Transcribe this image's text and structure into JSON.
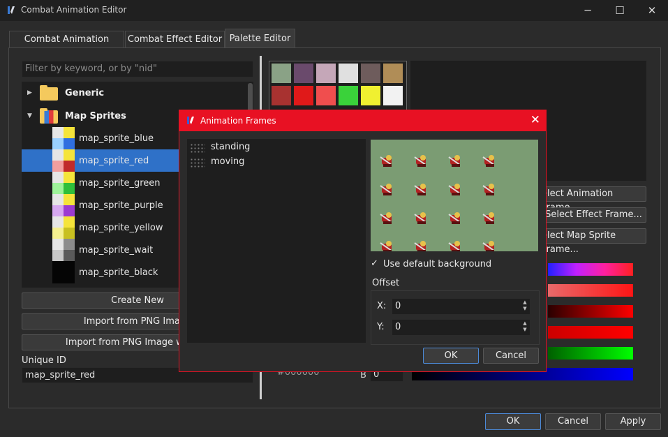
{
  "window": {
    "title": "Combat Animation Editor",
    "minimize": "─",
    "maximize": "☐",
    "close": "✕"
  },
  "tabs": [
    {
      "label": "Combat Animation Editor"
    },
    {
      "label": "Combat Effect Editor"
    },
    {
      "label": "Palette Editor"
    }
  ],
  "left": {
    "filter_placeholder": "Filter by keyword, or by \"nid\"",
    "groups": [
      {
        "label": "Generic",
        "arrow": "▶"
      },
      {
        "label": "Map Sprites",
        "arrow": "▼"
      }
    ],
    "items": [
      {
        "label": "map_sprite_blue"
      },
      {
        "label": "map_sprite_red"
      },
      {
        "label": "map_sprite_green"
      },
      {
        "label": "map_sprite_purple"
      },
      {
        "label": "map_sprite_yellow"
      },
      {
        "label": "map_sprite_wait"
      },
      {
        "label": "map_sprite_black"
      }
    ],
    "buttons": {
      "create_new": "Create New",
      "import_png": "Import from PNG Image",
      "import_png_with": "Import from PNG Image with ba"
    },
    "unique_id_label": "Unique ID",
    "unique_id_value": "map_sprite_red"
  },
  "palette": {
    "swatches": [
      "#8aa286",
      "#6a4a6c",
      "#c5a7b8",
      "#e0e0e0",
      "#6e5c5c",
      "#b08d57",
      "#a83230",
      "#e01919",
      "#f04e4e",
      "#3ad23a",
      "#f0f030",
      "#f2f2f2"
    ],
    "right_buttons": [
      "elect Animation Frame...",
      "Select Effect Frame...",
      "elect Map Sprite Frame..."
    ],
    "hex_partial": "#000000",
    "b_label": "B",
    "b_value": "0"
  },
  "dialog": {
    "title": "Animation Frames",
    "close": "✕",
    "frames": [
      {
        "label": "standing"
      },
      {
        "label": "moving"
      }
    ],
    "checkbox_mark": "✓",
    "use_default_bg": "Use default background",
    "offset_label": "Offset",
    "x_label": "X:",
    "x_value": "0",
    "y_label": "Y:",
    "y_value": "0",
    "ok": "OK",
    "cancel": "Cancel"
  },
  "bottom": {
    "ok": "OK",
    "cancel": "Cancel",
    "apply": "Apply"
  }
}
